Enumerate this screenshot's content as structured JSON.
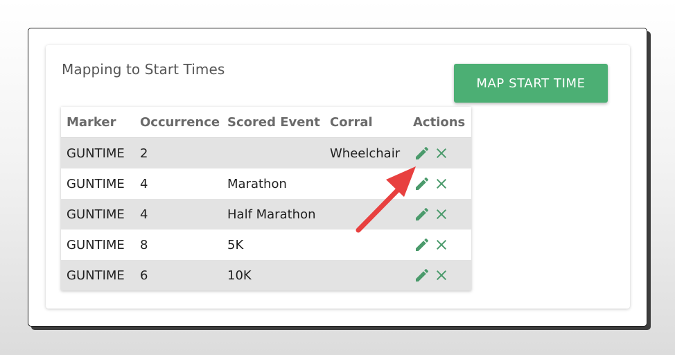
{
  "card": {
    "title": "Mapping to Start Times",
    "primary_button_label": "MAP START TIME"
  },
  "table": {
    "columns": [
      "Marker",
      "Occurrence",
      "Scored Event",
      "Corral",
      "Actions"
    ],
    "rows": [
      {
        "marker": "GUNTIME",
        "occurrence": "2",
        "scored_event": "",
        "corral": "Wheelchair"
      },
      {
        "marker": "GUNTIME",
        "occurrence": "4",
        "scored_event": "Marathon",
        "corral": ""
      },
      {
        "marker": "GUNTIME",
        "occurrence": "4",
        "scored_event": "Half Marathon",
        "corral": ""
      },
      {
        "marker": "GUNTIME",
        "occurrence": "8",
        "scored_event": "5K",
        "corral": ""
      },
      {
        "marker": "GUNTIME",
        "occurrence": "6",
        "scored_event": "10K",
        "corral": ""
      }
    ],
    "row_actions": [
      "pencil-icon",
      "close-icon"
    ]
  },
  "colors": {
    "accent": "#4caf74",
    "icon": "#4a9a6b",
    "striped_row": "#e3e3e3",
    "annotation_arrow": "#e8403f"
  }
}
